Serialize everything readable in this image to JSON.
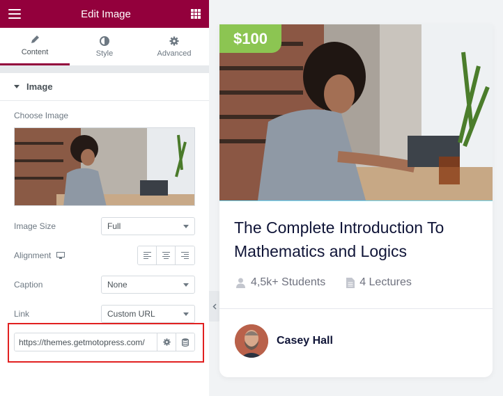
{
  "panel": {
    "title": "Edit Image",
    "tabs": [
      {
        "label": "Content",
        "icon": "pencil-icon",
        "active": true
      },
      {
        "label": "Style",
        "icon": "contrast-icon",
        "active": false
      },
      {
        "label": "Advanced",
        "icon": "gear-icon",
        "active": false
      }
    ],
    "section_title": "Image",
    "choose_image_label": "Choose Image",
    "image_size": {
      "label": "Image Size",
      "value": "Full"
    },
    "alignment": {
      "label": "Alignment"
    },
    "caption": {
      "label": "Caption",
      "value": "None"
    },
    "link": {
      "label": "Link",
      "value": "Custom URL"
    },
    "url": {
      "value": "https://themes.getmotopress.com/"
    }
  },
  "card": {
    "price": "$100",
    "title": "The Complete Introduction To Mathematics and Logics",
    "students": "4,5k+ Students",
    "lectures": "4 Lectures",
    "author": "Casey Hall"
  },
  "colors": {
    "brand": "#93003c",
    "price_badge": "#8cc552",
    "highlight": "#e12020"
  }
}
